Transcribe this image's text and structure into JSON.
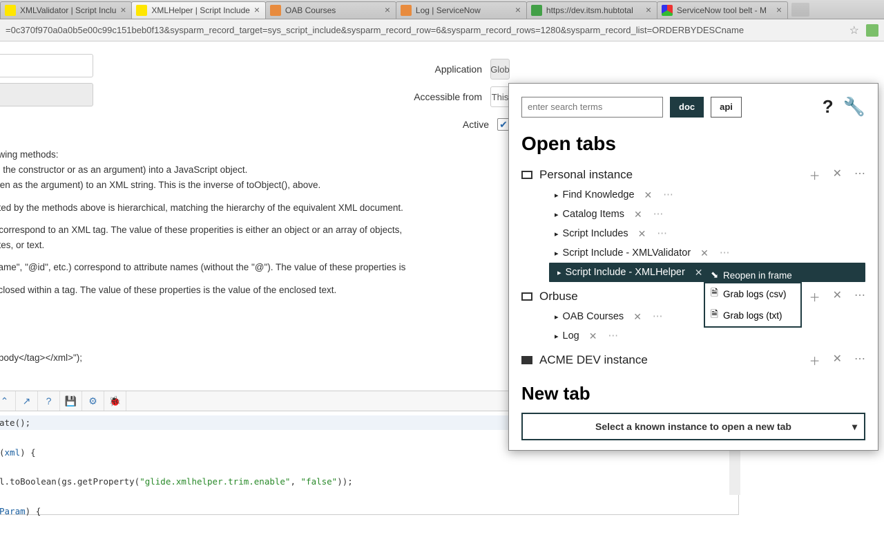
{
  "browser": {
    "tabs": [
      {
        "label": "XMLValidator | Script Inclu",
        "favicon": "fav-yellow"
      },
      {
        "label": "XMLHelper | Script Include",
        "favicon": "fav-yellow",
        "active": true
      },
      {
        "label": "OAB Courses",
        "favicon": "fav-orange"
      },
      {
        "label": "Log | ServiceNow",
        "favicon": "fav-orange"
      },
      {
        "label": "https://dev.itsm.hubtotal",
        "favicon": "fav-green-circle"
      },
      {
        "label": "ServiceNow tool belt - M",
        "favicon": "fav-multi"
      }
    ],
    "url_fragment": "=0c370f970a0a0b5e00c99c151beb0f13&sysparm_record_target=sys_script_include&sysparm_record_row=6&sysparm_record_rows=1280&sysparm_record_list=ORDERBYDESCname"
  },
  "form": {
    "application_label": "Application",
    "application_value": "Glob",
    "accessible_label": "Accessible from",
    "accessible_value": "This",
    "active_label": "Active"
  },
  "description": {
    "l1": "owing methods:",
    "l2": "in the constructor or as an argument) into a JavaScript object.",
    "l3": "iven as the argument) to an XML string.  This is the inverse of toObject(), above.",
    "l4": "eted by the methods above is hierarchical, matching the hierarchy of the equivalent XML document.",
    "l5": ") correspond to an XML tag.  The value of these properities is either an object or an array of objects,",
    "l6": "utes, or text.",
    "l7": "name\", \"@id\", etc.) correspond to attribute names (without the \"@\").  The value of these properties is",
    "l8": "nclosed within a tag.  The value of these properties is the value of the enclosed text.",
    "l9": ">body</tag></xml>\");"
  },
  "code": {
    "line1": "ate();",
    "line2a": "(",
    "line2arg": "xml",
    "line2b": ") {",
    "line3a": "l.toBoolean(gs.getProperty(",
    "line3s1": "\"glide.xmlhelper.trim.enable\"",
    "line3s2": "\"false\"",
    "line3b": "));",
    "line4a": "Param",
    "line4b": ") {"
  },
  "popup": {
    "search_placeholder": "enter search terms",
    "doc": "doc",
    "api": "api",
    "open_tabs_heading": "Open tabs",
    "new_tab_heading": "New tab",
    "select_placeholder": "Select a known instance to open a new tab",
    "groups": [
      {
        "name": "Personal instance",
        "tabs": [
          {
            "label": "Find Knowledge"
          },
          {
            "label": "Catalog Items"
          },
          {
            "label": "Script Includes"
          },
          {
            "label": "Script Include - XMLValidator"
          },
          {
            "label": "Script Include - XMLHelper",
            "selected": true
          }
        ]
      },
      {
        "name": "Orbuse",
        "tabs": [
          {
            "label": "OAB Courses"
          },
          {
            "label": "Log"
          }
        ]
      },
      {
        "name": "ACME DEV instance",
        "filled": true,
        "tabs": []
      }
    ],
    "context_menu": {
      "reopen": "Reopen in frame",
      "csv": "Grab logs (csv)",
      "txt": "Grab logs (txt)"
    }
  }
}
